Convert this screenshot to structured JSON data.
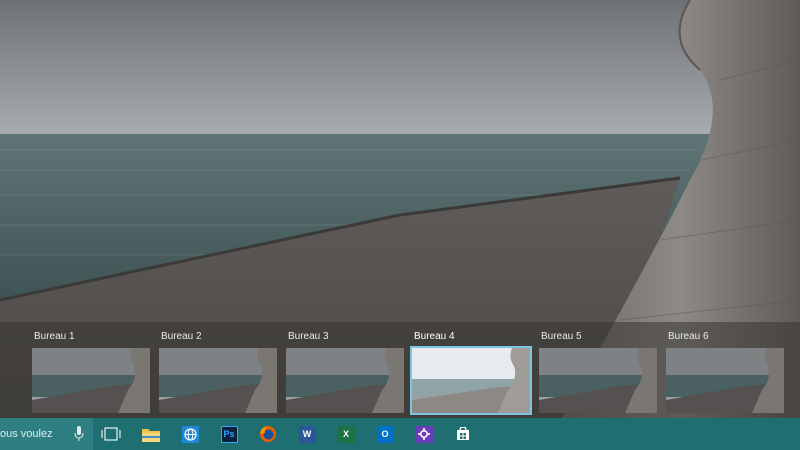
{
  "desktops": [
    {
      "label": "Bureau 1",
      "selected": false
    },
    {
      "label": "Bureau 2",
      "selected": false
    },
    {
      "label": "Bureau 3",
      "selected": false
    },
    {
      "label": "Bureau 4",
      "selected": true
    },
    {
      "label": "Bureau 5",
      "selected": false
    },
    {
      "label": "Bureau 6",
      "selected": false
    }
  ],
  "taskbar": {
    "search_text": "ous voulez",
    "apps": [
      {
        "name": "task-view",
        "icon": "task-view-icon"
      },
      {
        "name": "file-explorer",
        "icon": "folder-icon"
      },
      {
        "name": "internet-explorer",
        "icon": "globe-icon"
      },
      {
        "name": "photoshop",
        "icon": "photoshop-icon",
        "glyph": "Ps"
      },
      {
        "name": "firefox",
        "icon": "firefox-icon"
      },
      {
        "name": "word",
        "icon": "word-icon",
        "glyph": "W"
      },
      {
        "name": "excel",
        "icon": "excel-icon",
        "glyph": "X"
      },
      {
        "name": "outlook",
        "icon": "outlook-icon",
        "glyph": "O"
      },
      {
        "name": "settings",
        "icon": "gear-icon"
      },
      {
        "name": "store",
        "icon": "store-icon"
      }
    ],
    "colors": {
      "bar": "#1e6e72",
      "search": "#2f7e82",
      "accent": "#7cc6e0"
    }
  }
}
